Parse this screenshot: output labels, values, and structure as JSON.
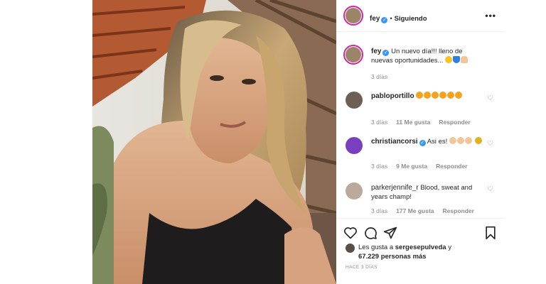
{
  "header": {
    "username": "fey",
    "separator": "•",
    "follow_status": "Siguiendo",
    "more_icon": "more-horizontal-icon"
  },
  "caption": {
    "username": "fey",
    "text": "Un nuevo día!!! lleno de nuevas oportunidades...",
    "time": "3 días"
  },
  "comments": [
    {
      "username": "pabloportillo",
      "verified": false,
      "text": "",
      "time": "3 días",
      "likes": "11 Me gusta",
      "reply": "Responder"
    },
    {
      "username": "christiancorsi",
      "verified": true,
      "text": "Asi es!",
      "time": "3 días",
      "likes": "9 Me gusta",
      "reply": "Responder"
    },
    {
      "username": "parkerjennife_r",
      "verified": false,
      "text": "Blood, sweat and years champ!",
      "time": "3 días",
      "likes": "177 Me gusta",
      "reply": "Responder"
    }
  ],
  "likes": {
    "prefix": "Les gusta a",
    "user": "sergesepulveda",
    "conj": "y",
    "count": "67.229 personas más"
  },
  "timestamp": "HACE 3 DÍAS",
  "colors": {
    "verified": "#3897f0",
    "story_ring": "#d6249f",
    "muted_text": "#8e8e8e",
    "border": "#efefef"
  }
}
